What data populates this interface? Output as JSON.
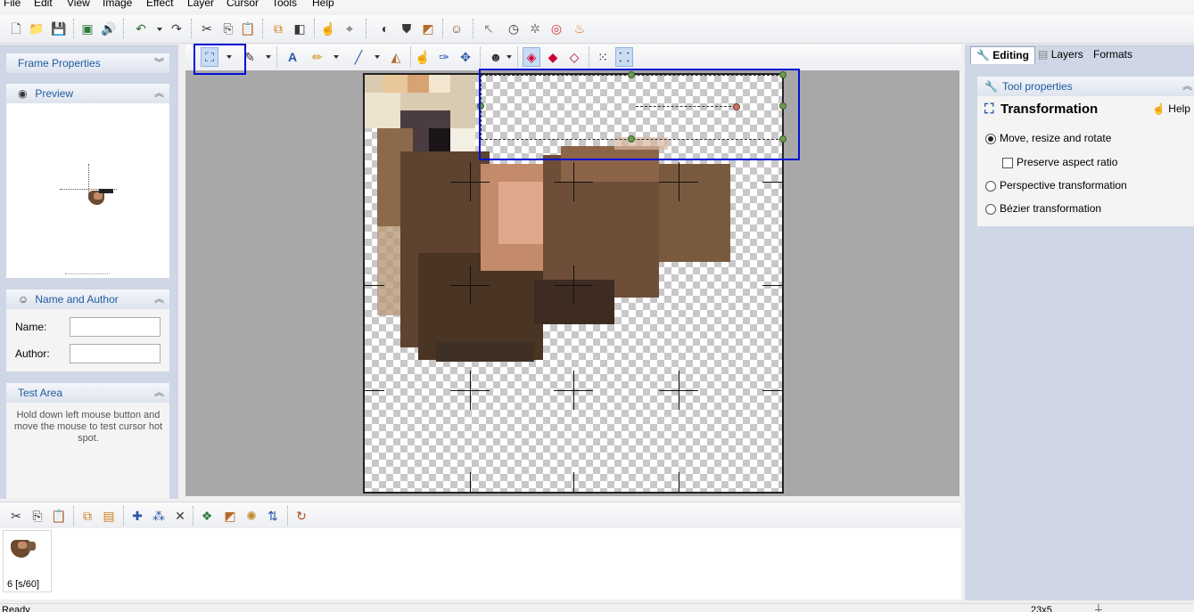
{
  "menu": [
    "File",
    "Edit",
    "View",
    "Image",
    "Effect",
    "Layer",
    "Cursor",
    "Tools",
    "Help"
  ],
  "left": {
    "frame_properties": "Frame Properties",
    "preview": "Preview",
    "name_and_author": "Name and Author",
    "name_label": "Name:",
    "author_label": "Author:",
    "name_value": "",
    "author_value": "",
    "test_area": "Test Area",
    "test_hint": "Hold down left mouse button and move the mouse to test cursor hot spot."
  },
  "right": {
    "tabs": [
      "Editing",
      "Layers",
      "Formats"
    ],
    "tool_properties": "Tool properties",
    "tool_title": "Transformation",
    "help": "Help",
    "options": {
      "move": "Move, resize and rotate",
      "preserve": "Preserve aspect ratio",
      "perspective": "Perspective transformation",
      "bezier": "Bézier transformation"
    },
    "selected_option": "move",
    "preserve_checked": false
  },
  "frames": [
    {
      "caption": "6 [s/60]"
    }
  ],
  "status": {
    "left": "Ready",
    "right": "23x5"
  },
  "colors": {
    "highlight": "#0010d6",
    "panel": "#cfd6e5",
    "accent_text": "#1e5a9e"
  }
}
